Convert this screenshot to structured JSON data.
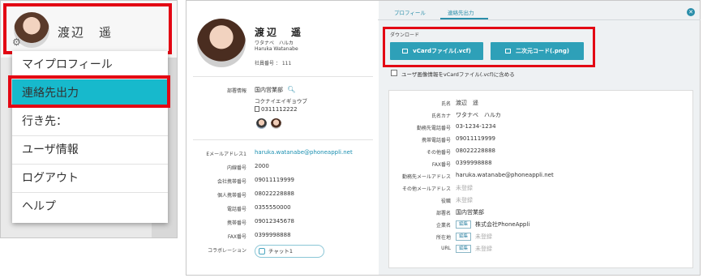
{
  "menu_panel": {
    "user_name": "渡辺　遥",
    "items": [
      {
        "label": "マイプロフィール"
      },
      {
        "label": "連絡先出力"
      },
      {
        "label": "行き先："
      },
      {
        "label": "ユーザ情報"
      },
      {
        "label": "ログアウト"
      },
      {
        "label": "ヘルプ"
      }
    ],
    "active_index": 1,
    "icons": {
      "settings": "gear-icon"
    },
    "colors": {
      "active_bg": "#17b9cc",
      "highlight": "#e30613"
    }
  },
  "profile": {
    "name": "渡辺　遥",
    "kana": "ワタナベ　ハルカ",
    "roman": "Haruka Watanabe",
    "employee_no": "社員番号 ： 111",
    "dept_label": "部署情報",
    "dept_name": "国内営業部",
    "dept_kana": "コクナイエイギョウブ",
    "dept_phone": "0311112222",
    "fields": [
      {
        "label": "Eメールアドレス1",
        "value": "haruka.watanabe@phoneappli.net"
      },
      {
        "label": "内線番号",
        "value": "2000"
      },
      {
        "label": "会社携帯番号",
        "value": "09011119999"
      },
      {
        "label": "個人携帯番号",
        "value": "08022228888"
      },
      {
        "label": "電話番号",
        "value": "0355550000"
      },
      {
        "label": "携帯番号",
        "value": "09012345678"
      },
      {
        "label": "FAX番号",
        "value": "0399998888"
      }
    ],
    "collab_label": "コラボレーション",
    "chat_label": "チャット1"
  },
  "tabs": [
    {
      "label": "プロフィール"
    },
    {
      "label": "連絡先出力"
    }
  ],
  "download": {
    "section_label": "ダウンロード",
    "vcard_button": "vCardファイル(.vcf)",
    "qr_button": "二次元コード(.png)",
    "checkbox_label": "ユーザ画像情報をvCardファイル(.vcf)に含める",
    "checkbox_checked": false
  },
  "details": {
    "edit_tag": "編集",
    "rows": [
      {
        "label": "氏名",
        "value": "渡辺　遥"
      },
      {
        "label": "氏名カナ",
        "value": "ワタナベ　ハルカ"
      },
      {
        "label": "勤務先電話番号",
        "value": "03-1234-1234"
      },
      {
        "label": "携帯電話番号",
        "value": "09011119999"
      },
      {
        "label": "その他番号",
        "value": "08022228888"
      },
      {
        "label": "FAX番号",
        "value": "0399998888"
      },
      {
        "label": "勤務先メールアドレス",
        "value": "haruka.watanabe@phoneappli.net"
      },
      {
        "label": "その他メールアドレス",
        "value": "未登録"
      },
      {
        "label": "役職",
        "value": "未登録"
      },
      {
        "label": "部署名",
        "value": "国内営業部"
      },
      {
        "label": "企業名",
        "value": "株式会社PhoneAppli"
      },
      {
        "label": "所在地",
        "value": "未登録"
      },
      {
        "label": "URL",
        "value": "未登録"
      }
    ]
  }
}
